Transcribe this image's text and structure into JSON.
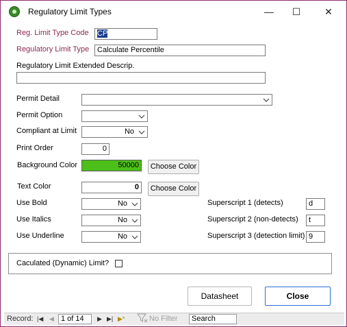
{
  "window": {
    "title": "Regulatory Limit Types",
    "minimize": "—",
    "maximize": "☐",
    "close": "✕"
  },
  "form": {
    "reg_limit_type_code": {
      "label": "Reg. Limit Type Code",
      "value": "CP"
    },
    "regulatory_limit_type": {
      "label": "Regulatory Limit Type",
      "value": "Calculate Percentile"
    },
    "extended_descrip": {
      "label": "Regulatory Limit Extended Descrip.",
      "value": ""
    },
    "permit_detail": {
      "label": "Permit Detail",
      "value": ""
    },
    "permit_option": {
      "label": "Permit Option",
      "value": ""
    },
    "compliant_at_limit": {
      "label": "Compliant at Limit",
      "value": "No"
    },
    "print_order": {
      "label": "Print Order",
      "value": "0"
    },
    "background_color": {
      "label": "Background  Color",
      "value": "50000",
      "swatch": "#4cbf1a",
      "button": "Choose Color"
    },
    "text_color": {
      "label": "Text  Color",
      "value": "0",
      "button": "Choose Color"
    },
    "use_bold": {
      "label": "Use Bold",
      "value": "No"
    },
    "use_italics": {
      "label": "Use Italics",
      "value": "No"
    },
    "use_underline": {
      "label": "Use Underline",
      "value": "No"
    },
    "superscript1": {
      "label": "Superscript 1 (detects)",
      "value": "d"
    },
    "superscript2": {
      "label": "Superscript 2 (non-detects)",
      "value": "t"
    },
    "superscript3": {
      "label": "Superscript 3 (detection limit)",
      "value": "9"
    },
    "calculated_limit": {
      "label": "Caculated (Dynamic) Limit?",
      "checked": false
    }
  },
  "buttons": {
    "datasheet": "Datasheet",
    "close": "Close"
  },
  "navigation": {
    "record_label": "Record:",
    "first": "|◀",
    "prev": "◀",
    "position": "1 of 14",
    "next": "▶",
    "last": "▶|",
    "new": "▶*",
    "filter": "No Filter",
    "search_placeholder": "Search"
  },
  "colors": {
    "label_maroon": "#8b2a52",
    "window_border": "#8b2a6e",
    "green_swatch": "#4cbf1a",
    "close_border": "#2a6ed6"
  }
}
